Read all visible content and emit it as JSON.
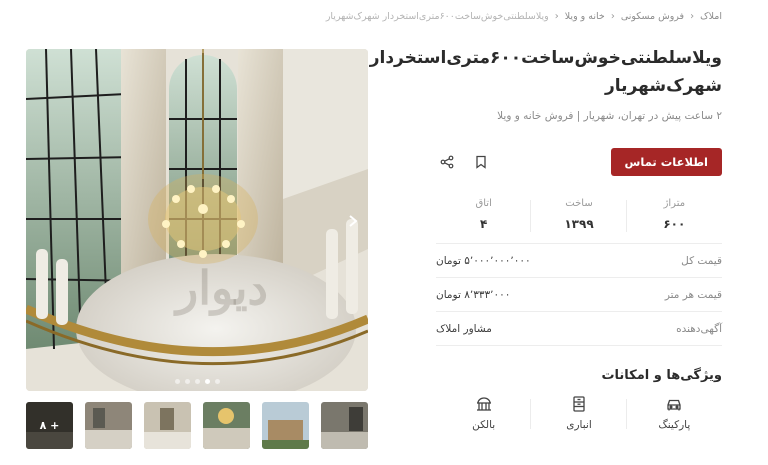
{
  "breadcrumb": [
    {
      "label": "املاک"
    },
    {
      "label": "فروش مسکونی"
    },
    {
      "label": "خانه و ویلا"
    },
    {
      "label": "ویلاسلطنتی‌خوش‌ساخت۶۰۰متری‌استخردار شهرک‌شهریار"
    }
  ],
  "listing": {
    "title": "ویلاسلطنتی‌خوش‌ساخت۶۰۰متری‌استخردار شهرک‌شهریار",
    "subtitle": "۲ ساعت پیش در تهران، شهریار | فروش خانه و ویلا",
    "contact_label": "اطلاعات تماس",
    "icons": {
      "bookmark": "bookmark-icon",
      "share": "share-icon"
    }
  },
  "stats": [
    {
      "label": "متراژ",
      "value": "۶۰۰"
    },
    {
      "label": "ساخت",
      "value": "۱۳۹۹"
    },
    {
      "label": "اتاق",
      "value": "۴"
    }
  ],
  "details": [
    {
      "label": "قیمت کل",
      "value": "۵٬۰۰۰٬۰۰۰٬۰۰۰ تومان"
    },
    {
      "label": "قیمت هر متر",
      "value": "۸٬۳۳۳٬۰۰۰ تومان"
    },
    {
      "label": "آگهی‌دهنده",
      "value": "مشاور املاک"
    }
  ],
  "features": {
    "title": "ویژگی‌ها و امکانات",
    "items": [
      {
        "label": "پارکینگ",
        "icon": "car-icon"
      },
      {
        "label": "انباری",
        "icon": "storage-icon"
      },
      {
        "label": "بالکن",
        "icon": "balcony-icon"
      }
    ]
  },
  "gallery": {
    "more_label": "۸ +",
    "watermark": "دیوار",
    "dot_count": 5,
    "active_dot": 3,
    "thumb_count": 6
  },
  "colors": {
    "accent": "#a62626",
    "text": "#2b2b2b",
    "muted": "#8a8a8a"
  }
}
